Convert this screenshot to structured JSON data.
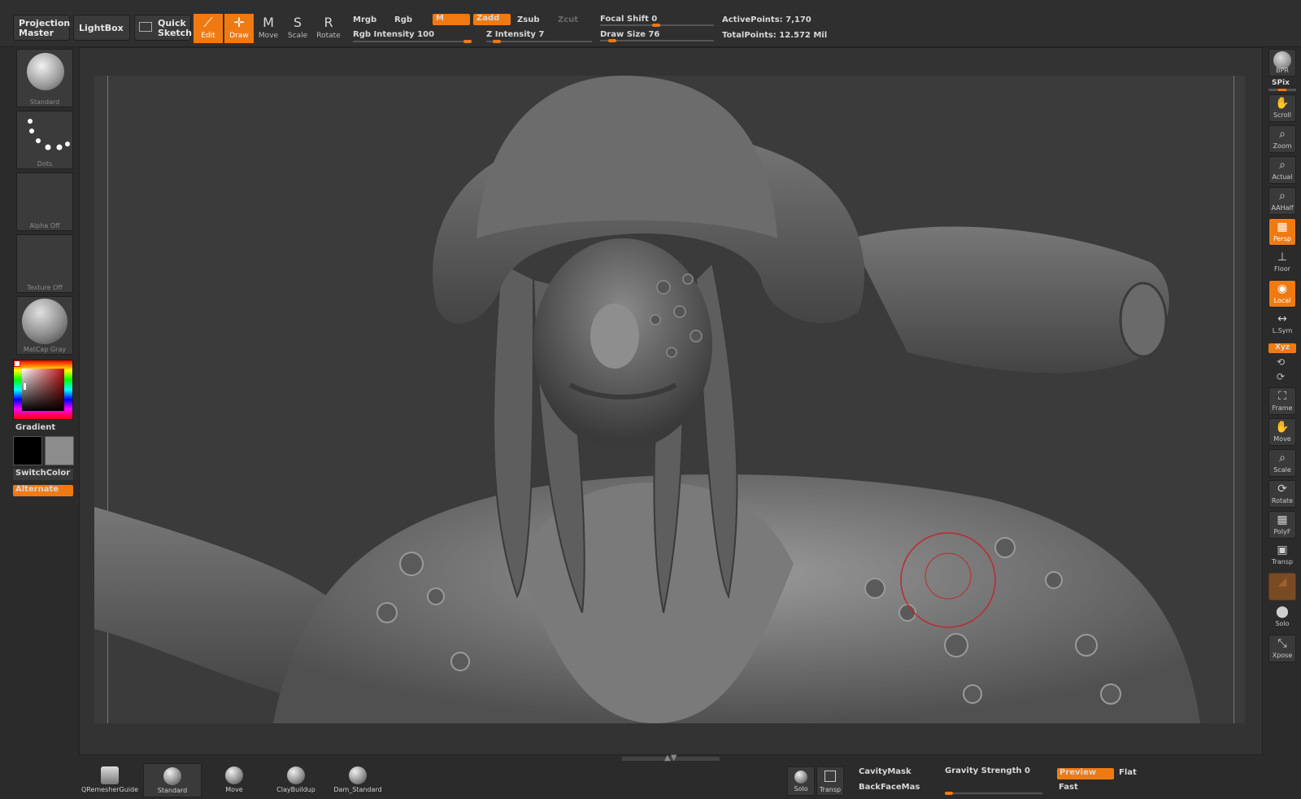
{
  "topbar": {
    "projection_master": "Projection Master",
    "lightbox": "LightBox",
    "quick_sketch": "Quick Sketch",
    "edit": "Edit",
    "draw": "Draw",
    "move": "Move",
    "scale": "Scale",
    "rotate": "Rotate",
    "mrgb": "Mrgb",
    "rgb": "Rgb",
    "m": "M",
    "zadd": "Zadd",
    "zsub": "Zsub",
    "zcut": "Zcut",
    "rgb_intensity": "Rgb Intensity 100",
    "z_intensity": "Z Intensity 7",
    "focal_shift": "Focal Shift 0",
    "draw_size": "Draw Size 76",
    "active_points": "ActivePoints: 7,170",
    "total_points": "TotalPoints: 12.572 Mil",
    "rgb_intensity_value": 100,
    "z_intensity_value": 7,
    "draw_size_value": 76
  },
  "left": {
    "brush": "Standard",
    "stroke": "Dots",
    "alpha": "Alpha Off",
    "texture": "Texture Off",
    "material": "MatCap Gray",
    "gradient": "Gradient",
    "switch_color": "SwitchColor",
    "alternate": "Alternate"
  },
  "right": {
    "bpr": "BPR",
    "spix": "SPix",
    "scroll": "Scroll",
    "zoom": "Zoom",
    "actual": "Actual",
    "aahalf": "AAHalf",
    "persp": "Persp",
    "floor": "Floor",
    "local": "Local",
    "lsym": "L.Sym",
    "xyz": "Xyz",
    "frame": "Frame",
    "move": "Move",
    "scale": "Scale",
    "rotate": "Rotate",
    "polyf": "PolyF",
    "transp": "Transp",
    "solo": "Solo",
    "xpose": "Xpose"
  },
  "bottom": {
    "brushes": [
      "QRemesherGuide",
      "Standard",
      "Move",
      "ClayBuildup",
      "Dam_Standard"
    ],
    "solo": "Solo",
    "transp": "Transp",
    "cavity_mask": "CavityMask",
    "backface_mask": "BackFaceMas",
    "gravity_strength": "Gravity Strength 0",
    "preview": "Preview",
    "flat": "Flat",
    "fast": "Fast"
  },
  "colors": {
    "accent": "#f07a12",
    "bg": "#2b2b2b",
    "canvas": "#3a3a3a",
    "brush_circle": "#c0282a"
  },
  "icons": [
    "sphere-icon",
    "dots-stroke-icon",
    "hand-icon",
    "magnifier-icon",
    "persp-grid-icon",
    "floor-icon",
    "local-icon",
    "sym-arrows-icon",
    "frame-icon",
    "rotate-icon",
    "polyframe-icon",
    "cube-icon"
  ]
}
